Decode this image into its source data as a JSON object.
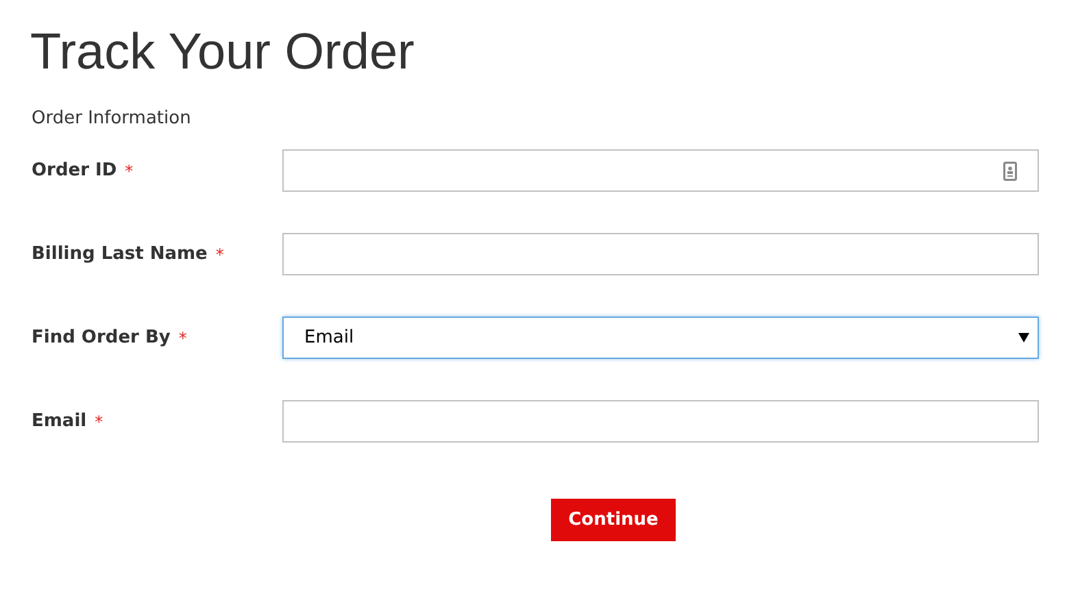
{
  "title": "Track Your Order",
  "section": "Order Information",
  "fields": [
    {
      "label": "Order ID",
      "required_mark": "*",
      "kind": "text",
      "autofill_icon": true,
      "focused": false
    },
    {
      "label": "Billing Last Name",
      "required_mark": "*",
      "kind": "text",
      "autofill_icon": false,
      "focused": false
    },
    {
      "label": "Find Order By",
      "required_mark": "*",
      "kind": "select",
      "value": "Email",
      "focused": true
    },
    {
      "label": "Email",
      "required_mark": "*",
      "kind": "text",
      "autofill_icon": false,
      "focused": false
    }
  ],
  "submit": "Continue"
}
